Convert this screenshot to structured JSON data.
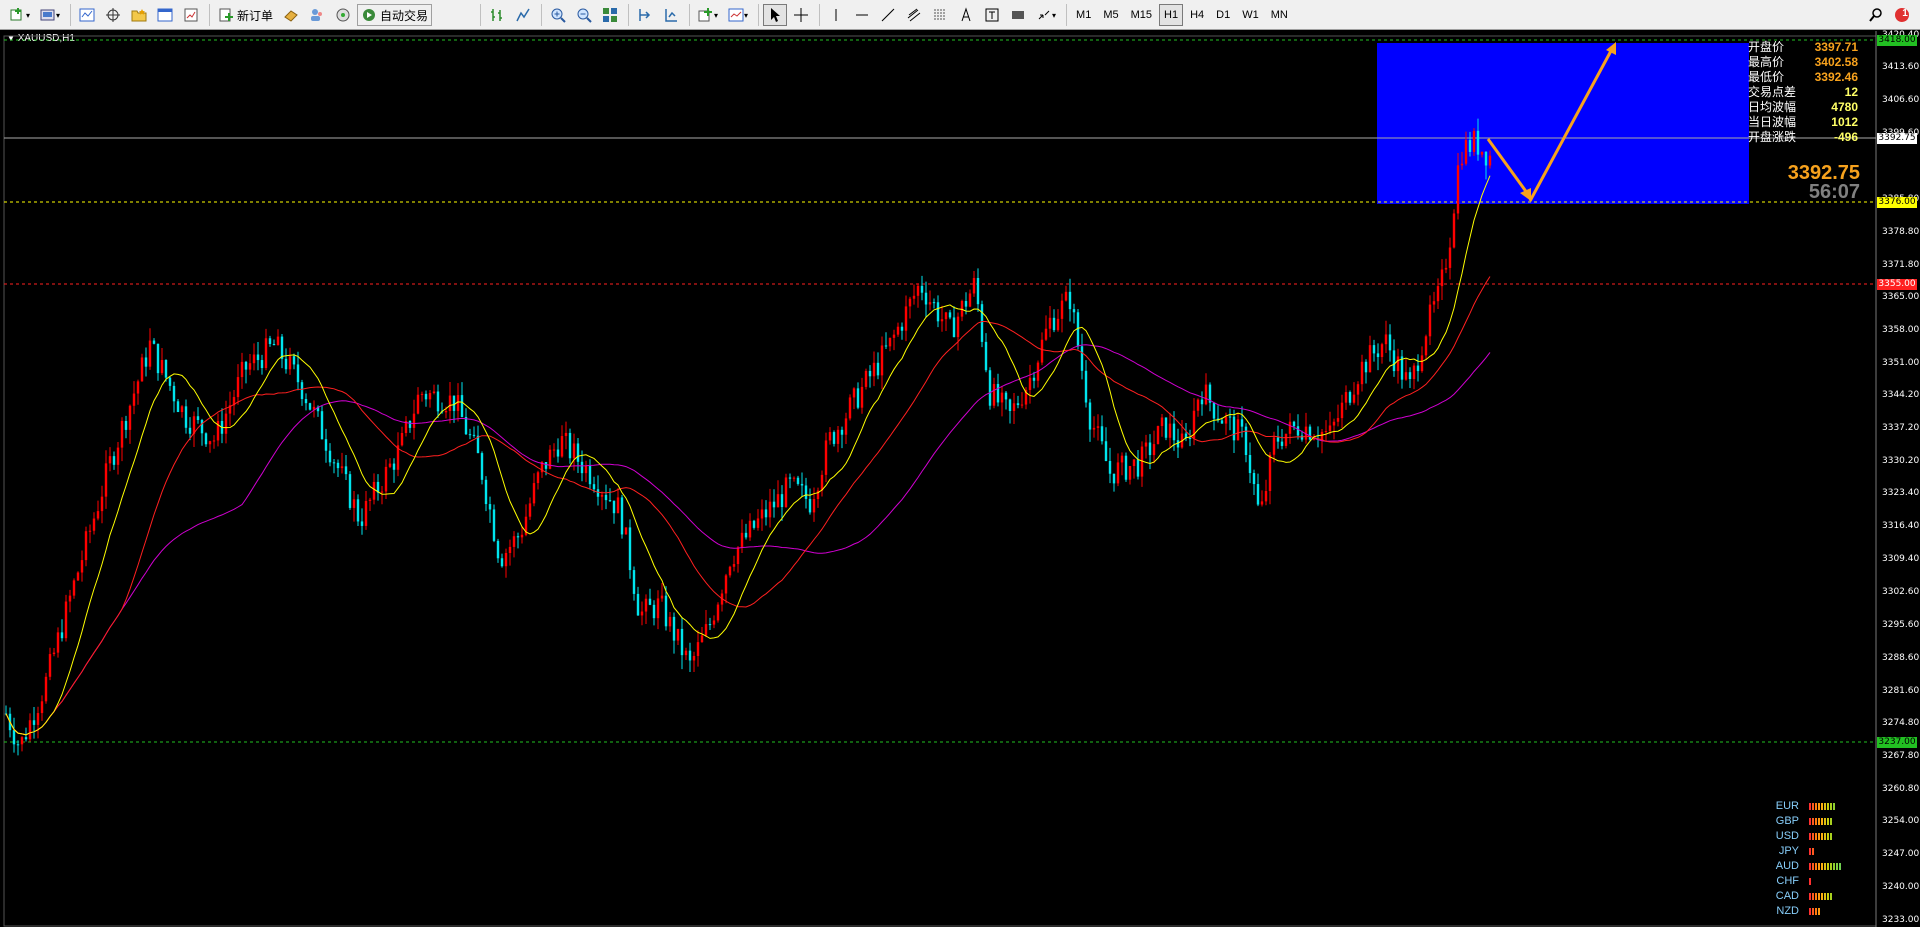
{
  "toolbar": {
    "new_order_label": "新订单",
    "auto_trade_label": "自动交易",
    "timeframes": [
      "M1",
      "M5",
      "M15",
      "H1",
      "H4",
      "D1",
      "W1",
      "MN"
    ],
    "active_timeframe": "H1",
    "notification_count": "1"
  },
  "chart": {
    "symbol_title": "XAUUSD,H1",
    "price_axis": [
      "3420.40",
      "3413.60",
      "3406.60",
      "3399.60",
      "3392.75",
      "3385.80",
      "3378.80",
      "3376.00",
      "3371.80",
      "3365.00",
      "3358.00",
      "3355.00",
      "3351.00",
      "3344.20",
      "3337.20",
      "3330.20",
      "3323.40",
      "3316.40",
      "3309.40",
      "3302.60",
      "3295.60",
      "3288.60",
      "3281.60",
      "3274.80",
      "3267.80",
      "3260.80",
      "3254.00",
      "3247.00",
      "3240.00",
      "3237.00",
      "3233.00"
    ],
    "price_levels": {
      "green_top": "3418.00",
      "current": "3392.75",
      "yellow": "3376.00",
      "red": "3355.00",
      "green_bottom": "3237.00"
    },
    "big_price": "3392.75",
    "countdown": "56:07"
  },
  "info_panel": [
    {
      "label": "开盘价",
      "value": "3397.71",
      "color": "#f7a21d"
    },
    {
      "label": "最高价",
      "value": "3402.58",
      "color": "#f7a21d"
    },
    {
      "label": "最低价",
      "value": "3392.46",
      "color": "#f7a21d"
    },
    {
      "label": "交易点差",
      "value": "12",
      "color": "#ffff66"
    },
    {
      "label": "日均波幅",
      "value": "4780",
      "color": "#ffff66"
    },
    {
      "label": "当日波幅",
      "value": "1012",
      "color": "#ffff66"
    },
    {
      "label": "开盘涨跌",
      "value": "-496",
      "color": "#ffff66"
    }
  ],
  "currencies": [
    {
      "name": "EUR",
      "strength": 9
    },
    {
      "name": "GBP",
      "strength": 8
    },
    {
      "name": "USD",
      "strength": 8
    },
    {
      "name": "JPY",
      "strength": 2
    },
    {
      "name": "AUD",
      "strength": 11
    },
    {
      "name": "CHF",
      "strength": 1
    },
    {
      "name": "CAD",
      "strength": 8
    },
    {
      "name": "NZD",
      "strength": 4
    }
  ],
  "colors": {
    "bull": "#ff0000",
    "bear": "#00e5ee",
    "ma_fast": "#ffff00",
    "ma_mid": "#ff2020",
    "ma_slow": "#d000d0",
    "zone": "#0000ff",
    "arrow": "#f7a21d"
  }
}
